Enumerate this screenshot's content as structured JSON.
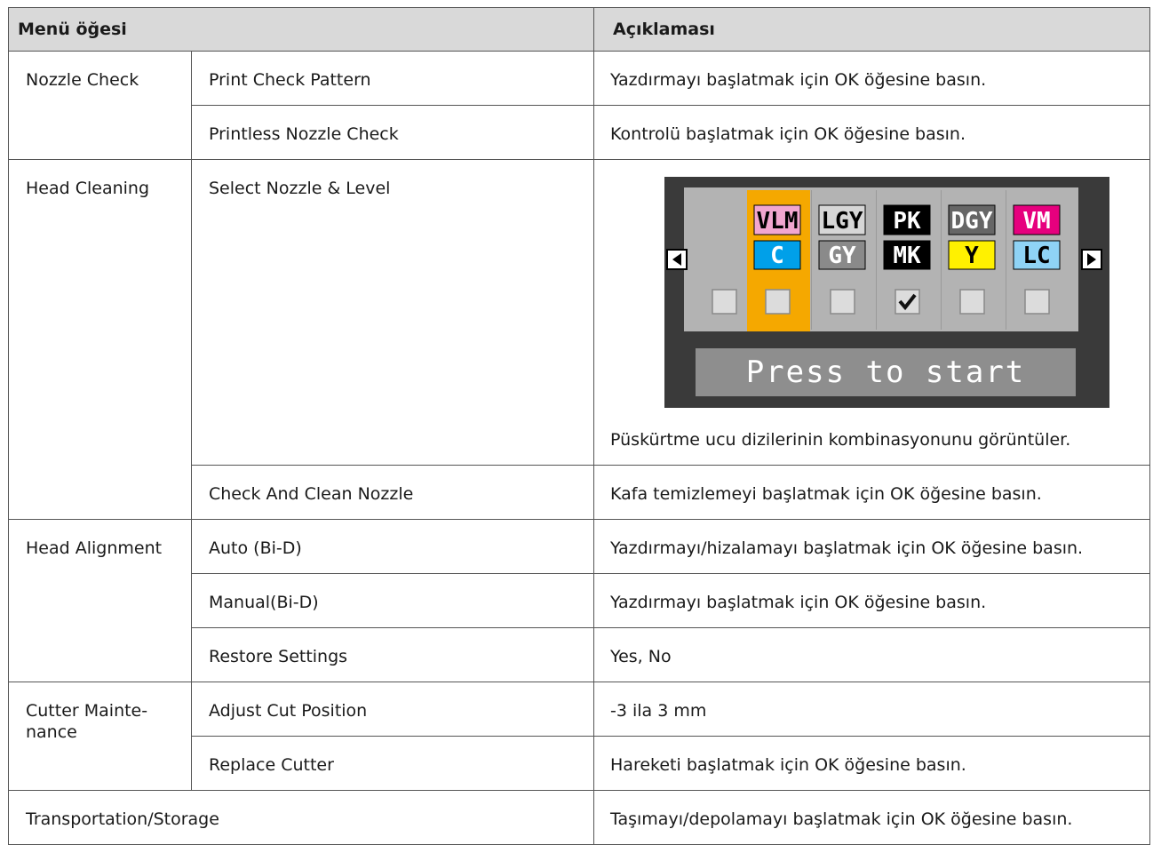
{
  "header": {
    "col1": "Menü öğesi",
    "col3": "Açıklaması"
  },
  "rows": {
    "nozzle_check": {
      "label": "Nozzle Check",
      "items": [
        {
          "label": "Print Check Pattern",
          "desc": "Yazdırmayı başlatmak için OK öğesine basın."
        },
        {
          "label": "Printless Nozzle Check",
          "desc": "Kontrolü başlatmak için OK öğesine basın."
        }
      ]
    },
    "head_cleaning": {
      "label": "Head Cleaning",
      "items": [
        {
          "label": "Select Nozzle & Level",
          "desc": "Püskürtme ucu dizilerinin kombinasyonunu görüntüler."
        },
        {
          "label": "Check And Clean Nozzle",
          "desc": "Kafa temizlemeyi başlatmak için OK öğesine basın."
        }
      ]
    },
    "head_alignment": {
      "label": "Head Alignment",
      "items": [
        {
          "label": "Auto (Bi-D)",
          "desc": "Yazdırmayı/hizalamayı başlatmak için OK öğesine basın."
        },
        {
          "label": "Manual(Bi-D)",
          "desc": "Yazdırmayı başlatmak için OK öğesine basın."
        },
        {
          "label": "Restore Settings",
          "desc": "Yes, No"
        }
      ]
    },
    "cutter": {
      "label_line1": "Cutter Mainte-",
      "label_line2": "nance",
      "items": [
        {
          "label": "Adjust Cut Position",
          "desc": "-3 ila 3 mm"
        },
        {
          "label": "Replace Cutter",
          "desc": "Hareketi başlatmak için OK öğesine basın."
        }
      ]
    },
    "transport": {
      "label": "Transportation/Storage",
      "desc": "Taşımayı/depolamayı başlatmak için OK öğesine basın."
    }
  },
  "lcd": {
    "prompt": "Press to start",
    "left_arrow_icon": "triangle-left-icon",
    "right_arrow_icon": "triangle-right-icon",
    "inks_top": [
      {
        "label": "VLM",
        "bg": "#f2a6cf",
        "fg": "#000000"
      },
      {
        "label": "LGY",
        "bg": "#d6d6d6",
        "fg": "#000000"
      },
      {
        "label": "PK",
        "bg": "#000000",
        "fg": "#ffffff"
      },
      {
        "label": "DGY",
        "bg": "#666666",
        "fg": "#ffffff"
      },
      {
        "label": "VM",
        "bg": "#e6007e",
        "fg": "#ffffff"
      }
    ],
    "inks_bottom": [
      {
        "label": "C",
        "bg": "#00a0e9",
        "fg": "#ffffff"
      },
      {
        "label": "GY",
        "bg": "#8a8a8a",
        "fg": "#ffffff"
      },
      {
        "label": "MK",
        "bg": "#000000",
        "fg": "#ffffff"
      },
      {
        "label": "Y",
        "bg": "#fff100",
        "fg": "#000000"
      },
      {
        "label": "LC",
        "bg": "#8fd3f5",
        "fg": "#000000"
      }
    ],
    "checked_column": 2,
    "highlight_column": 0,
    "colors": {
      "screen": "#3a3a3a",
      "panel": "#b3b3b3",
      "highlight": "#f5a800"
    }
  }
}
